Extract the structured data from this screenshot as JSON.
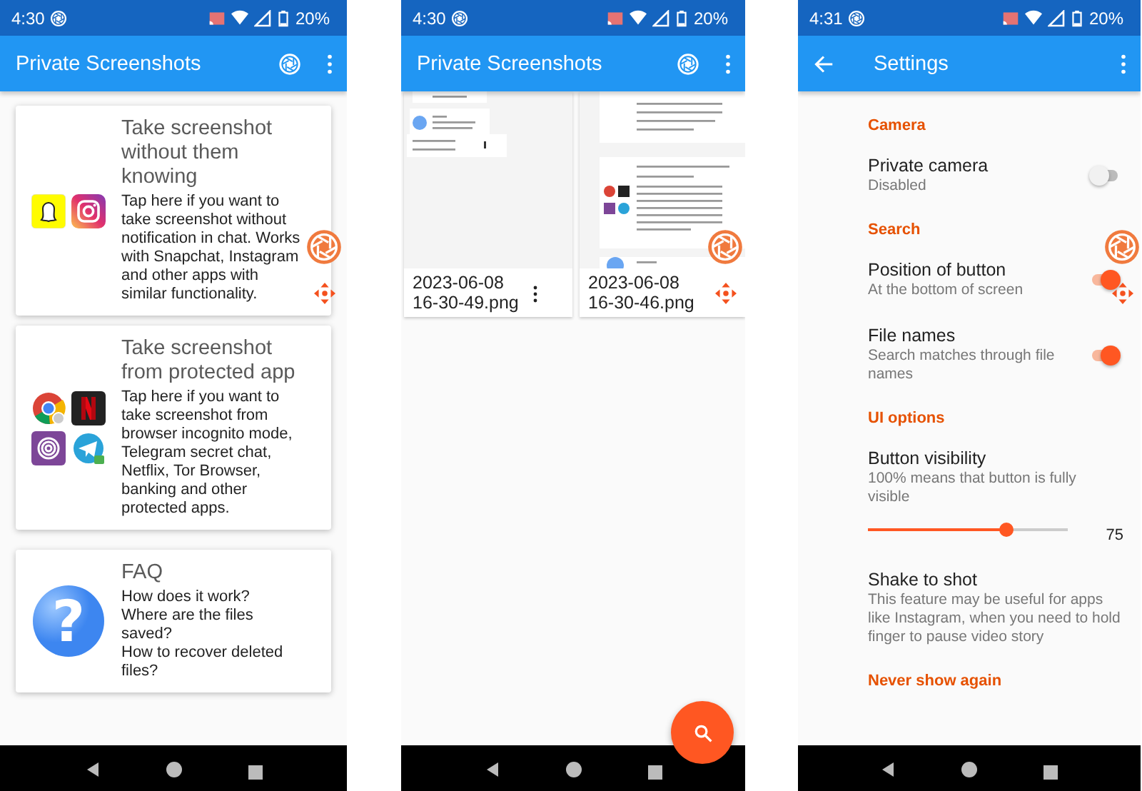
{
  "phones": [
    {
      "kind": "home",
      "status": {
        "time": "4:30",
        "battery": "20%"
      },
      "app_bar": {
        "title": "Private Screenshots"
      },
      "floating_controls": true,
      "cards": [
        {
          "kind": "social",
          "title": "Take screenshot without them knowing",
          "body": "Tap here if you want to take screenshot without notification in chat. Works with Snapchat, Instagram and other apps with similar functionality."
        },
        {
          "kind": "protected",
          "title": "Take screenshot from protected app",
          "body": "Tap here if you want to take screenshot from browser incognito mode, Telegram secret chat, Netflix, Tor Browser, banking and other protected apps."
        },
        {
          "kind": "faq",
          "title": "FAQ",
          "icon_glyph": "?",
          "body": "How does it work?\nWhere are the files saved?\nHow to recover deleted files?"
        }
      ]
    },
    {
      "kind": "gallery",
      "status": {
        "time": "4:30",
        "battery": "20%"
      },
      "app_bar": {
        "title": "Private Screenshots"
      },
      "floating_controls": true,
      "files": [
        {
          "kind": "scrolled",
          "name": "2023-06-08 16-30-49.png"
        },
        {
          "kind": "cards",
          "name": "2023-06-08 16-30-46.png"
        }
      ]
    },
    {
      "kind": "settings",
      "status": {
        "time": "4:31",
        "battery": "20%"
      },
      "app_bar": {
        "title": "Settings"
      },
      "floating_controls": true,
      "sections": [
        {
          "header": "Camera",
          "items": [
            {
              "kind": "switch",
              "title": "Private camera",
              "summary": "Disabled",
              "on": false
            }
          ]
        },
        {
          "header": "Search",
          "items": [
            {
              "kind": "switch",
              "title": "Position of button",
              "summary": "At the bottom of screen",
              "on": true
            },
            {
              "kind": "switch",
              "title": "File names",
              "summary": "Search matches through file names",
              "on": true
            }
          ]
        },
        {
          "header": "UI options",
          "items": [
            {
              "kind": "slider",
              "title": "Button visibility",
              "summary": "100% means that button is fully visible",
              "level": 0.69,
              "reading": "75"
            },
            {
              "kind": "text",
              "title": "Shake to shot",
              "summary": "This feature may be useful for apps like Instagram, when you need to hold finger to pause video story"
            }
          ]
        },
        {
          "header": "Never show again"
        }
      ]
    }
  ]
}
